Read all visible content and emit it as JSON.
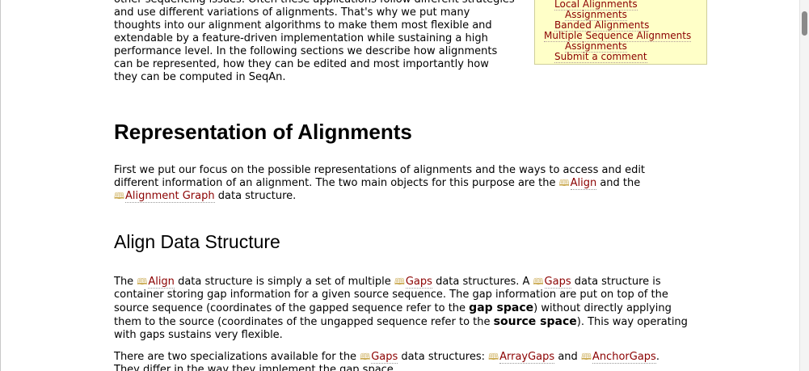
{
  "intro_lines": [
    "other sequencing issues. Often these applications follow different strategies",
    "and use different variations of alignments. That's why we put many",
    "thoughts into our alignment algorithms to make them most flexible and",
    "extendable by a feature-driven implementation while sustaining a high",
    "performance level. In the following sections we describe how alignments",
    "can be represented, how they can be edited and most importantly how",
    "they can be computed in SeqAn."
  ],
  "toc": {
    "items": [
      {
        "label": "Local Alignments",
        "level": 1
      },
      {
        "label": "Assignments",
        "level": 2
      },
      {
        "label": "Banded Alignments",
        "level": 1
      },
      {
        "label": "Multiple Sequence Alignments",
        "level": 0
      },
      {
        "label": "Assignments",
        "level": 2
      },
      {
        "label": "Submit a comment",
        "level": 1
      }
    ]
  },
  "sections": {
    "representation": {
      "heading": "Representation of Alignments",
      "p1": "First we put our focus on the possible representations of alignments and the ways to access and edit",
      "p2a": "different information of an alignment. The two main objects for this purpose are the",
      "link_align": "Align",
      "p2b": "and the",
      "link_graph": "Alignment Graph",
      "p3": "data structure."
    },
    "align": {
      "heading": "Align Data Structure",
      "l1a": "The",
      "l1_align": "Align",
      "l1b": "data structure is simply a set of multiple",
      "l1_gaps": "Gaps",
      "l1c": "data structures. A",
      "l1_gaps2": "Gaps",
      "l1d": "data structure is",
      "l2": "container storing gap information for a given source sequence. The gap information are put on top of the",
      "l3a": "source sequence (coordinates of the gapped sequence refer to the",
      "l3_strong": "gap space",
      "l3b": ") without directly applying",
      "l4a": "them to the source (coordinates of the ungapped sequence refer to the",
      "l4_strong": "source space",
      "l4b": "). This way operating",
      "l5": "with gaps sustains very flexible.",
      "l6a": "There are two specializations available for the",
      "l6_gaps": "Gaps",
      "l6b": "data structures:",
      "l6_array": "ArrayGaps",
      "l6c": "and",
      "l6_anchor": "AnchorGaps",
      "l6d": ".",
      "l7": "They differ in the way they implement the gap space."
    }
  },
  "icons": {
    "doc_link": "book-icon"
  }
}
